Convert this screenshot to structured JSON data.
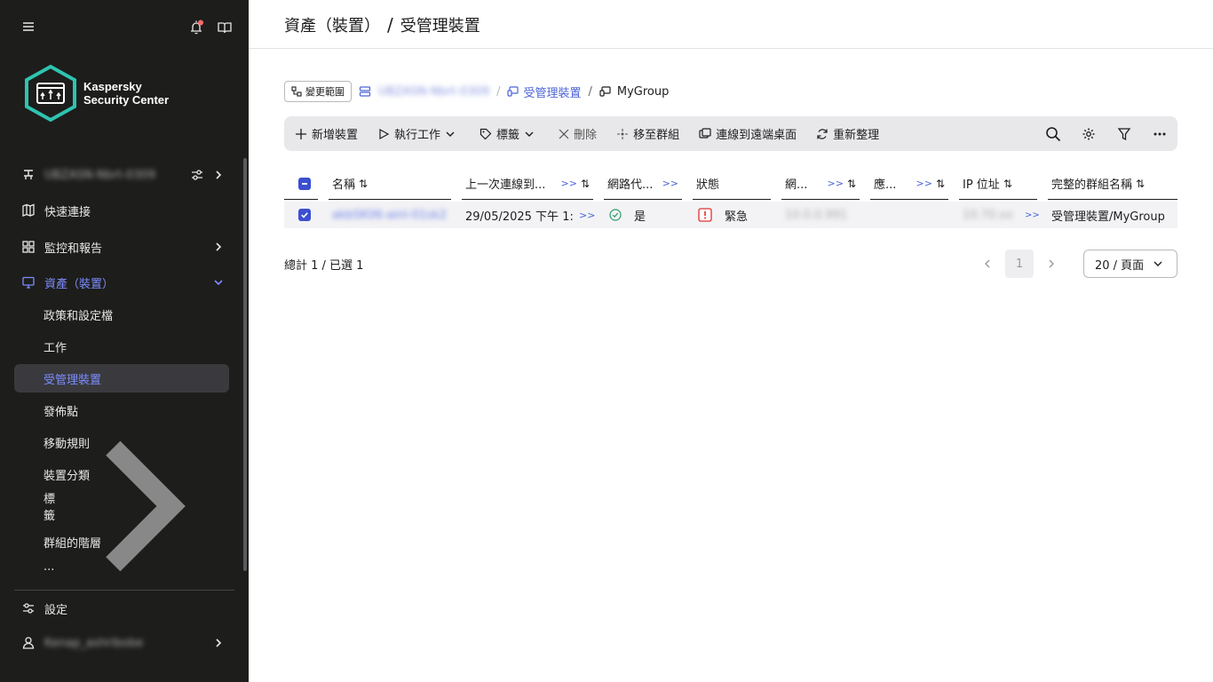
{
  "sidebar": {
    "brand_line1": "Kaspersky",
    "brand_line2": "Security Center",
    "server_name": "UBZASN-Nbrt-0309",
    "items": [
      {
        "label": "快速連接"
      },
      {
        "label": "監控和報告"
      },
      {
        "label": "資產（裝置）"
      }
    ],
    "sub_items": [
      {
        "label": "政策和設定檔"
      },
      {
        "label": "工作"
      },
      {
        "label": "受管理裝置"
      },
      {
        "label": "發佈點"
      },
      {
        "label": "移動規則"
      },
      {
        "label": "裝置分類"
      },
      {
        "label": "標籤"
      },
      {
        "label": "群組的階層"
      },
      {
        "label": "..."
      }
    ],
    "settings_label": "設定",
    "user_name": "Kenap_ashribobe"
  },
  "header": {
    "title_part1": "資產（裝置）",
    "title_sep": "/",
    "title_part2": "受管理裝置"
  },
  "breadcrumb": {
    "scope_button": "變更範圍",
    "server": "UBZASN-Nbrt-0309",
    "sep": "/",
    "managed_devices": "受管理裝置",
    "group": "MyGroup"
  },
  "toolbar": {
    "add_device": "新增裝置",
    "run_task": "執行工作",
    "tags": "標籤",
    "delete": "刪除",
    "move_to_group": "移至群組",
    "remote_desktop": "連線到遠端桌面",
    "refresh": "重新整理"
  },
  "table": {
    "columns": [
      "名稱",
      "上一次連線到...",
      "網路代...",
      "狀態",
      "網...",
      "應...",
      "IP 位址",
      "完整的群組名稱"
    ],
    "more_label": ">>",
    "sort_glyph": "⇅",
    "rows": [
      {
        "name": "akbSK06-ainl-01sk2",
        "last_connected": "29/05/2025 下午 1:",
        "agent": "是",
        "status": "緊急",
        "network": "10.0.0.991",
        "app": "",
        "ip": "10.70.xx",
        "group": "受管理裝置/MyGroup"
      }
    ]
  },
  "footer": {
    "total": "總計 1 / 已選 1",
    "page": "1",
    "per_page": "20 / 頁面"
  },
  "colors": {
    "accent": "#4b63d8",
    "sidebar_bg": "#1d1d1b",
    "brand_teal": "#2ec4b0",
    "status_critical": "#e03030",
    "agent_ok": "#2e9c6a"
  }
}
